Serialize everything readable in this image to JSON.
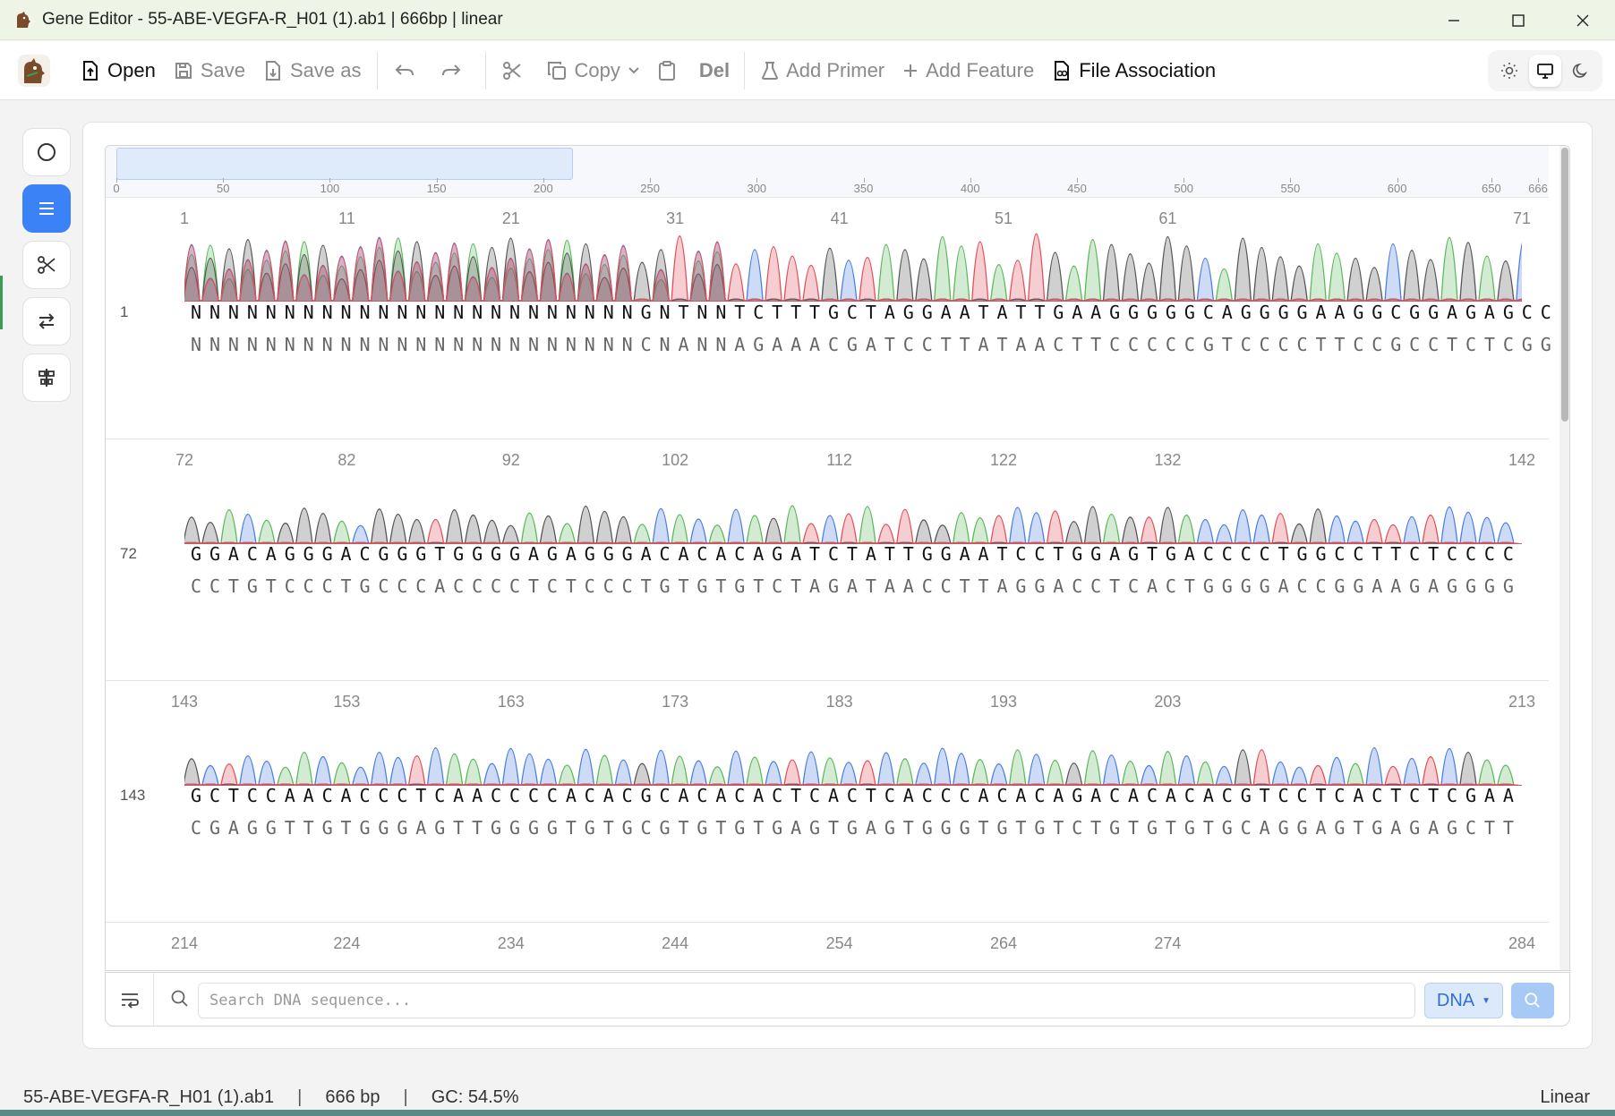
{
  "window": {
    "title": "Gene Editor - 55-ABE-VEGFA-R_H01 (1).ab1 | 666bp | linear"
  },
  "toolbar": {
    "open": "Open",
    "save": "Save",
    "save_as": "Save as",
    "copy": "Copy",
    "del": "Del",
    "add_primer": "Add Primer",
    "add_feature": "Add Feature",
    "file_association": "File Association"
  },
  "overview": {
    "ticks": [
      "0",
      "50",
      "100",
      "150",
      "200",
      "250",
      "300",
      "350",
      "400",
      "450",
      "500",
      "550",
      "600",
      "650",
      "666"
    ]
  },
  "rows": [
    {
      "start": "1",
      "positions": [
        "1",
        "11",
        "21",
        "31",
        "41",
        "51",
        "61",
        "71"
      ],
      "top": "NNNNNNNNNNNNNNNNNNNNNNNNGNTNNTCTTTGCTAGGAATATTGAAGGGGGCAGGGGAAGGCGGAGAGCC",
      "bottom": "NNNNNNNNNNNNNNNNNNNNNNNNCNANNAGAAACGATCCTTATAACTTCCCCCGTCCCCTTCCGCCTCTCGG"
    },
    {
      "start": "72",
      "positions": [
        "72",
        "82",
        "92",
        "102",
        "112",
        "122",
        "132",
        "142"
      ],
      "top": "GGACAGGGACGGGTGGGGAGAGGGACACACAGATCTATTGGAATCCTGGAGTGACCCCTGGCCTTCTCCCC",
      "bottom": "CCTGTCCCTGCCCACCCCTCTCCCTGTGTGTCTAGATAACCTTAGGACCTCACTGGGGACCGGAAGAGGGG"
    },
    {
      "start": "143",
      "positions": [
        "143",
        "153",
        "163",
        "173",
        "183",
        "193",
        "203",
        "213"
      ],
      "top": "GCTCCAACACCCTCAACCCCACACGCACACACTCACTCACCCACACAGACACACACGTCCTCACTCTCGAA",
      "bottom": "CGAGGTTGTGGGAGTTGGGGTGTGCGTGTGTGAGTGAGTGGGTGTGTCTGTGTGTGCAGGAGTGAGAGCTT"
    },
    {
      "start": "214",
      "positions": [
        "214",
        "224",
        "234",
        "244",
        "254",
        "264",
        "274",
        "284"
      ]
    }
  ],
  "search": {
    "placeholder": "Search DNA sequence...",
    "type": "DNA"
  },
  "status": {
    "file": "55-ABE-VEGFA-R_H01 (1).ab1",
    "sep": "|",
    "length": "666 bp",
    "gc": "GC: 54.5%",
    "mode": "Linear"
  },
  "colors": {
    "accent": "#3b82f6",
    "trace_A": "#5cb85c",
    "trace_C": "#4a7fe0",
    "trace_G": "#555555",
    "trace_T": "#e0505a"
  }
}
